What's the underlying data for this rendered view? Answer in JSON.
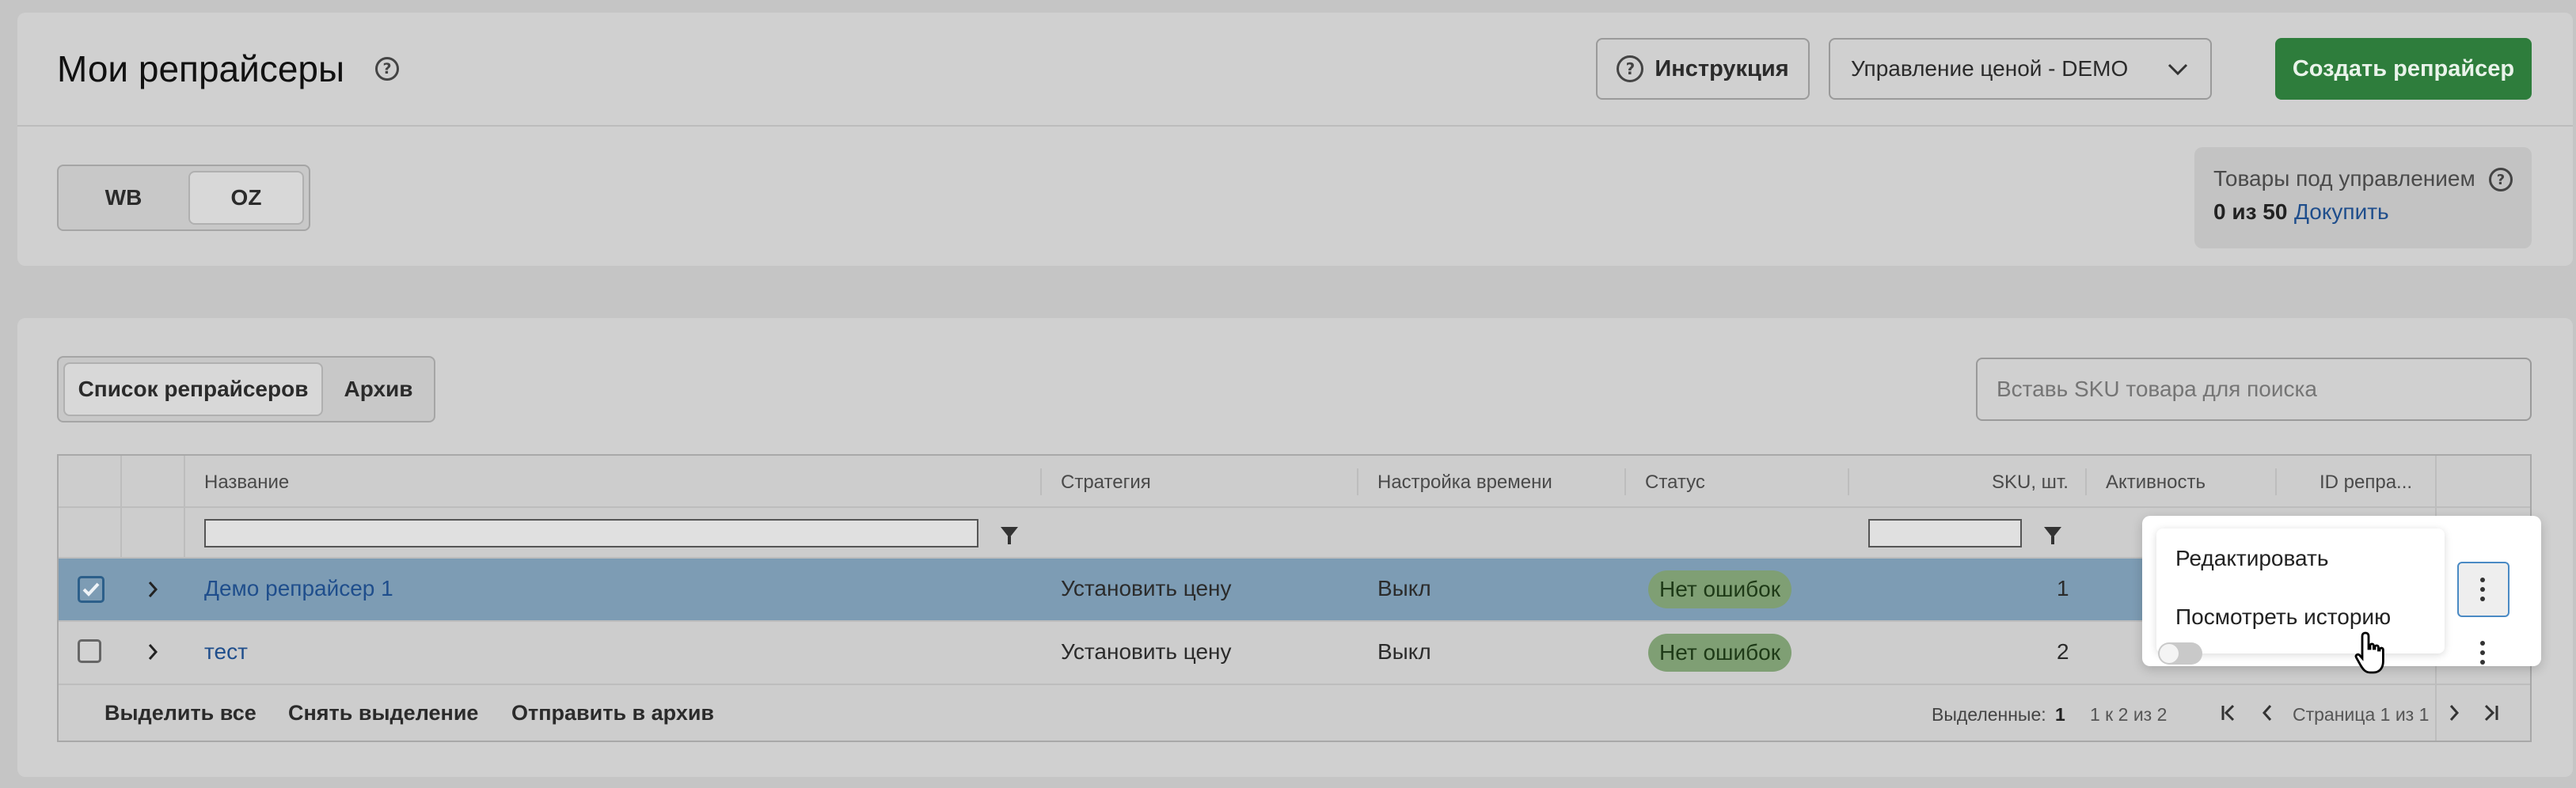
{
  "header": {
    "title": "Мои репрайсеры",
    "instruction_label": "Инструкция",
    "store_select_value": "Управление ценой - DEMO",
    "create_label": "Создать репрайсер"
  },
  "marketplace_tabs": [
    "WB",
    "OZ"
  ],
  "quota": {
    "label": "Товары под управлением",
    "count": "0 из 50",
    "buy_label": "Докупить"
  },
  "list_tabs": [
    "Список репрайсеров",
    "Архив"
  ],
  "search": {
    "placeholder": "Вставь SKU товара для поиска"
  },
  "table": {
    "columns": {
      "name": "Название",
      "strategy": "Стратегия",
      "time": "Настройка времени",
      "status": "Статус",
      "sku": "SKU, шт.",
      "activity": "Активность",
      "id": "ID репра..."
    },
    "rows": [
      {
        "name": "Демо репрайсер 1",
        "strategy": "Установить цену",
        "time": "Выкл",
        "status": "Нет ошибок",
        "sku": "1",
        "selected": true
      },
      {
        "name": "тест",
        "strategy": "Установить цену",
        "time": "Выкл",
        "status": "Нет ошибок",
        "sku": "2",
        "selected": false
      }
    ]
  },
  "footer": {
    "select_all": "Выделить все",
    "deselect": "Снять выделение",
    "archive": "Отправить в архив",
    "selected_label": "Выделенные:",
    "selected_count": "1",
    "range": "1 к 2 из 2",
    "page": "Страница 1 из 1"
  },
  "context_menu": [
    "Редактировать",
    "Посмотреть историю"
  ],
  "colors": {
    "accent_green": "#2e7d3c",
    "link_blue": "#1f4e8c",
    "selected_row": "#7d9cb4",
    "status_badge": "#7f9f74"
  }
}
